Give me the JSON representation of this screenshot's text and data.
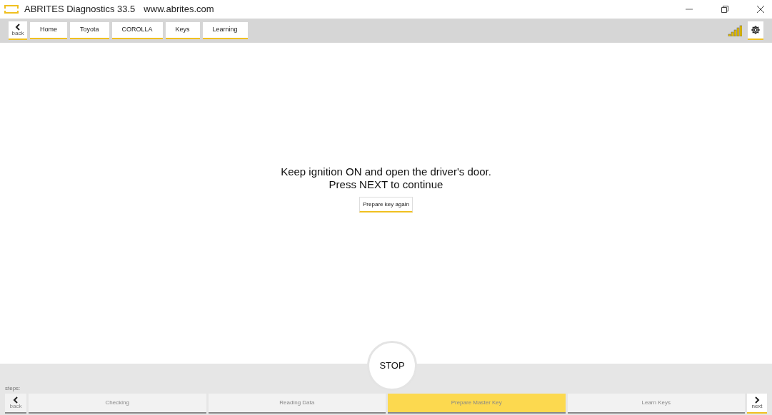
{
  "window": {
    "title": "ABRITES Diagnostics 33.5",
    "url": "www.abrites.com"
  },
  "toolbar": {
    "back_label": "back",
    "breadcrumbs": [
      "Home",
      "Toyota",
      "COROLLA",
      "Keys",
      "Learning"
    ]
  },
  "message": {
    "lines": [
      "Keep ignition ON and open the driver's door.",
      "Press NEXT to continue"
    ],
    "button": "Prepare key again"
  },
  "stop_button": "STOP",
  "steps": {
    "label": "steps:",
    "back_label": "back",
    "next_label": "next",
    "items": [
      {
        "label": "Checking",
        "selected": false
      },
      {
        "label": "Reading Data",
        "selected": false
      },
      {
        "label": "Prepare Master Key",
        "selected": true
      },
      {
        "label": "Learn Keys",
        "selected": false
      }
    ]
  }
}
